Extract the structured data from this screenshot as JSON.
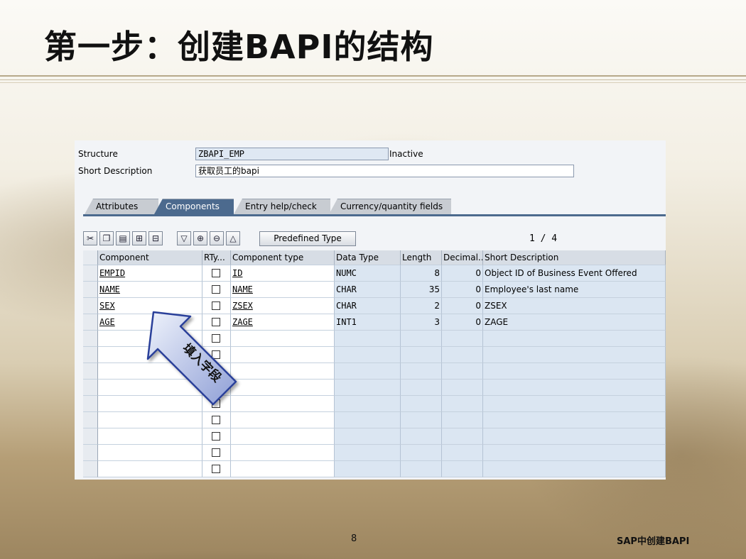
{
  "slide": {
    "title": "第一步：创建BAPI的结构",
    "page_number": "8",
    "footer": "SAP中创建BAPI"
  },
  "form": {
    "structure_label": "Structure",
    "structure_value": "ZBAPI_EMP",
    "status": "Inactive",
    "short_desc_label": "Short Description",
    "short_desc_value": "获取员工的bapi"
  },
  "tabs": [
    {
      "label": "Attributes",
      "active": false
    },
    {
      "label": "Components",
      "active": true
    },
    {
      "label": "Entry help/check",
      "active": false
    },
    {
      "label": "Currency/quantity fields",
      "active": false
    }
  ],
  "toolbar": {
    "icons": [
      "cut-icon",
      "copy-icon",
      "paste-icon",
      "insert-row-icon",
      "delete-row-icon",
      "filter-icon",
      "expand-icon",
      "collapse-icon",
      "up-icon"
    ],
    "predefined_type_label": "Predefined Type",
    "page_indicator": "1 / 4"
  },
  "table": {
    "headers": [
      "Component",
      "RTy...",
      "Component type",
      "Data Type",
      "Length",
      "Decimal...",
      "Short Description"
    ],
    "rows": [
      {
        "component": "EMPID",
        "component_type": "ID",
        "data_type": "NUMC",
        "length": "8",
        "decimal": "0",
        "short_description": "Object ID of Business Event Offered"
      },
      {
        "component": "NAME",
        "component_type": "NAME",
        "data_type": "CHAR",
        "length": "35",
        "decimal": "0",
        "short_description": "Employee's last name"
      },
      {
        "component": "SEX",
        "component_type": "ZSEX",
        "data_type": "CHAR",
        "length": "2",
        "decimal": "0",
        "short_description": "ZSEX"
      },
      {
        "component": "AGE",
        "component_type": "ZAGE",
        "data_type": "INT1",
        "length": "3",
        "decimal": "0",
        "short_description": "ZAGE"
      }
    ],
    "empty_rows": 9
  },
  "callout": {
    "text": "填入字段",
    "colors": {
      "fill_top": "#eef2fb",
      "fill_bottom": "#8f9fd6",
      "stroke": "#2a3f9a"
    }
  },
  "colors": {
    "active_tab": "#4c6a8e",
    "grid_blue": "#dbe6f2",
    "header_gray": "#d7dde5"
  }
}
